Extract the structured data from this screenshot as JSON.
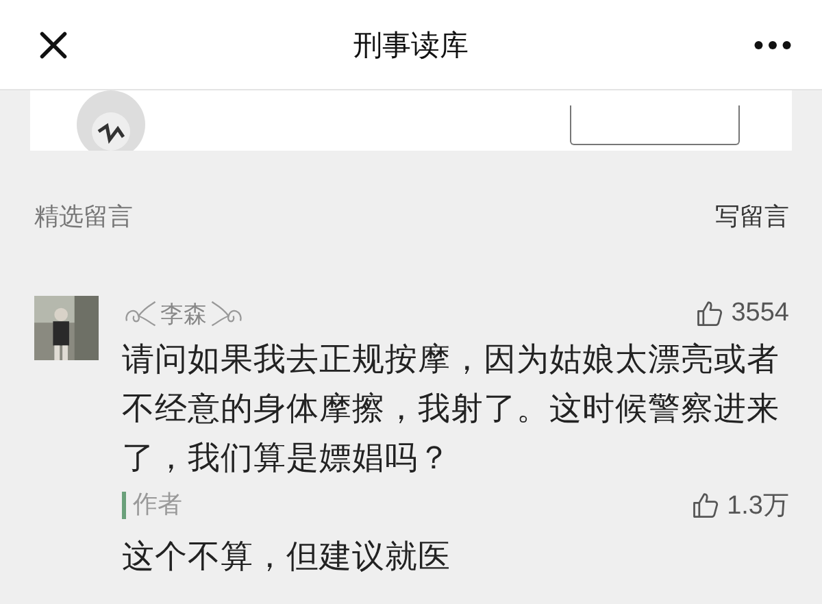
{
  "header": {
    "title": "刑事读库"
  },
  "section": {
    "title": "精选留言",
    "write_link": "写留言"
  },
  "comments": [
    {
      "author": "李森",
      "likes": "3554",
      "text": "请问如果我去正规按摩，因为姑娘太漂亮或者不经意的身体摩擦，我射了。这时候警察进来了，我们算是嫖娼吗？",
      "reply": {
        "label": "作者",
        "likes": "1.3万",
        "text": "这个不算，但建议就医"
      }
    }
  ]
}
